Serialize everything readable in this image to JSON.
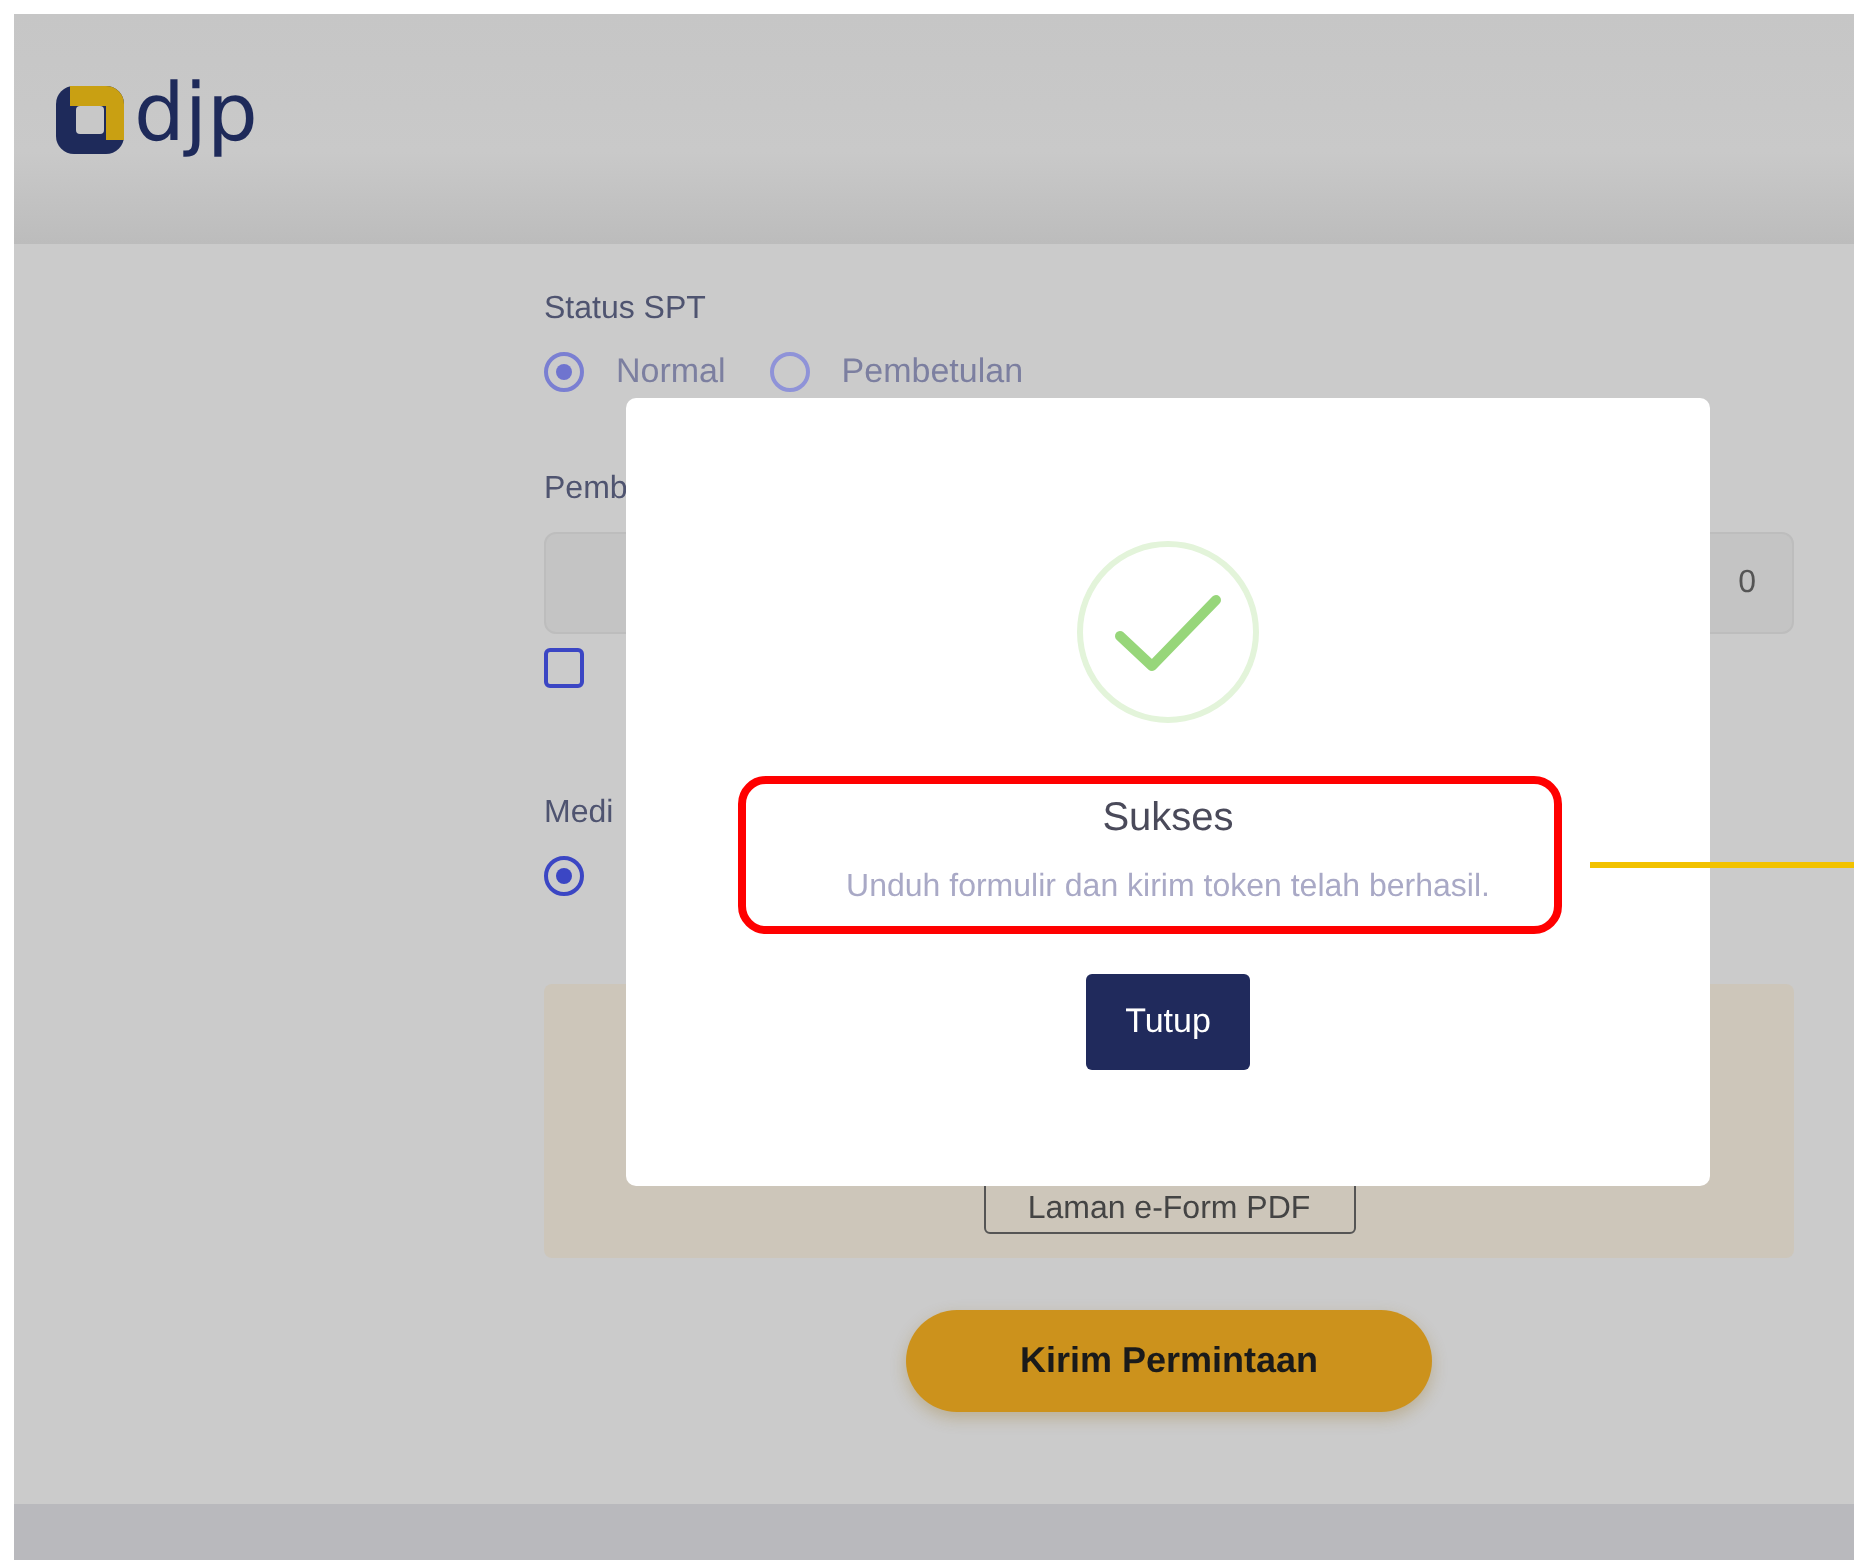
{
  "header": {
    "logo_text": "djp"
  },
  "form": {
    "status_label": "Status SPT",
    "status_options": [
      {
        "label": "Normal",
        "selected": true
      },
      {
        "label": "Pembetulan",
        "selected": false
      }
    ],
    "field_label": "Pemb",
    "field_value": "0",
    "checkbox": {
      "checked": false
    },
    "media_label": "Medi",
    "media_options": [
      {
        "selected": true
      }
    ],
    "panel_button": "Laman e-Form PDF",
    "submit_button": "Kirim Permintaan"
  },
  "dialog": {
    "title": "Sukses",
    "message": "Unduh formulir dan kirim token telah berhasil.",
    "button": "Tutup"
  }
}
